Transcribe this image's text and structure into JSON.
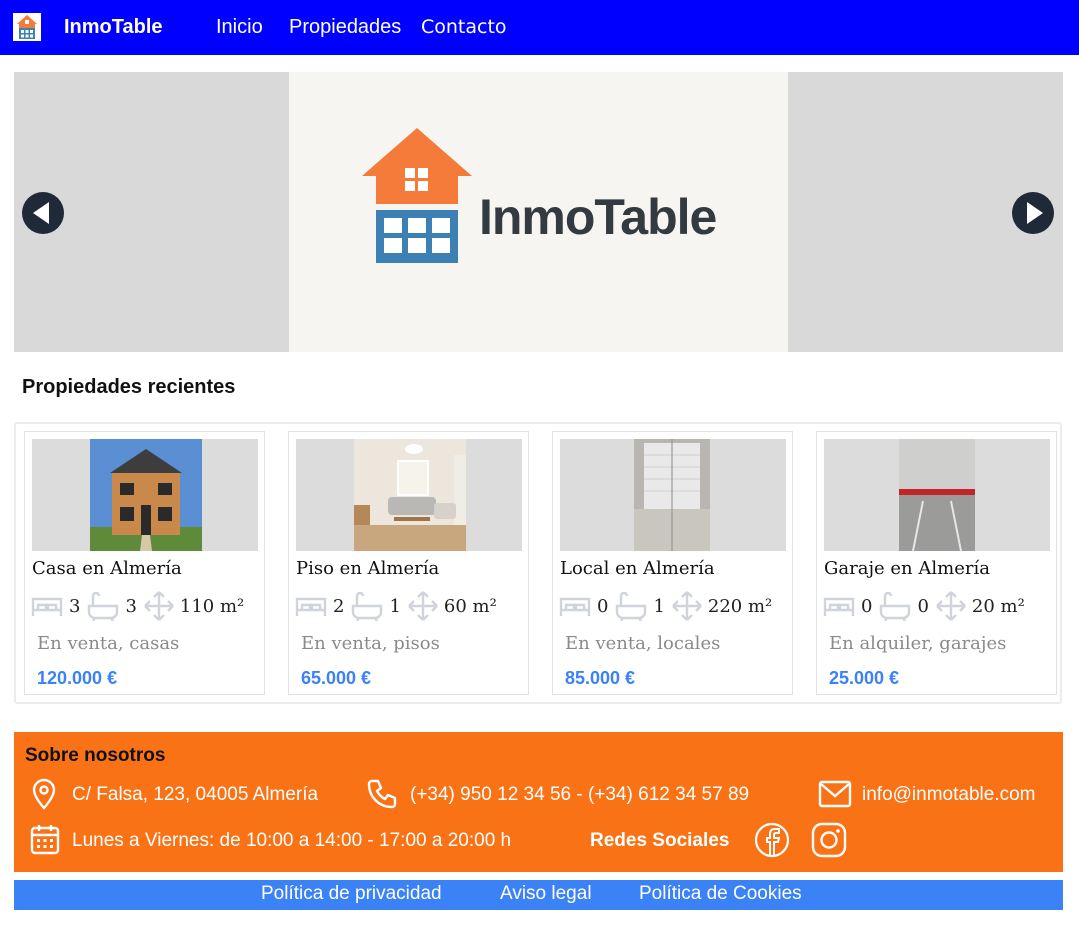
{
  "header": {
    "brand": "InmoTable",
    "nav": [
      "Inicio",
      "Propiedades",
      "Contacto"
    ]
  },
  "carousel": {
    "wordmark": "InmoTable",
    "prev_icon": "arrow-left-circle-icon",
    "next_icon": "arrow-right-circle-icon"
  },
  "section_title": "Propiedades recientes",
  "properties": [
    {
      "title": "Casa en Almería",
      "beds": "3",
      "baths": "3",
      "area": "110 m²",
      "category": "En venta, casas",
      "price": "120.000 €"
    },
    {
      "title": "Piso en Almería",
      "beds": "2",
      "baths": "1",
      "area": "60 m²",
      "category": "En venta, pisos",
      "price": "65.000 €"
    },
    {
      "title": "Local en Almería",
      "beds": "0",
      "baths": "1",
      "area": "220 m²",
      "category": "En venta, locales",
      "price": "85.000 €"
    },
    {
      "title": "Garaje en Almería",
      "beds": "0",
      "baths": "0",
      "area": "20 m²",
      "category": "En alquiler, garajes",
      "price": "25.000 €"
    }
  ],
  "about": {
    "title": "Sobre nosotros",
    "address": "C/ Falsa, 123, 04005 Almería",
    "phone": "(+34) 950 12 34 56 - (+34) 612 34 57 89",
    "email": "info@inmotable.com",
    "hours": "Lunes a Viernes: de 10:00 a 14:00 - 17:00 a 20:00 h",
    "social_label": "Redes Sociales"
  },
  "legal": [
    "Política de privacidad",
    "Aviso legal",
    "Política de Cookies"
  ],
  "colors": {
    "header_bg": "#0000ff",
    "footer_orange": "#f97316",
    "footer_blue": "#3b82f6",
    "price": "#3b82f6",
    "logo_roof": "#f47b3a",
    "logo_body": "#3d80b3"
  }
}
